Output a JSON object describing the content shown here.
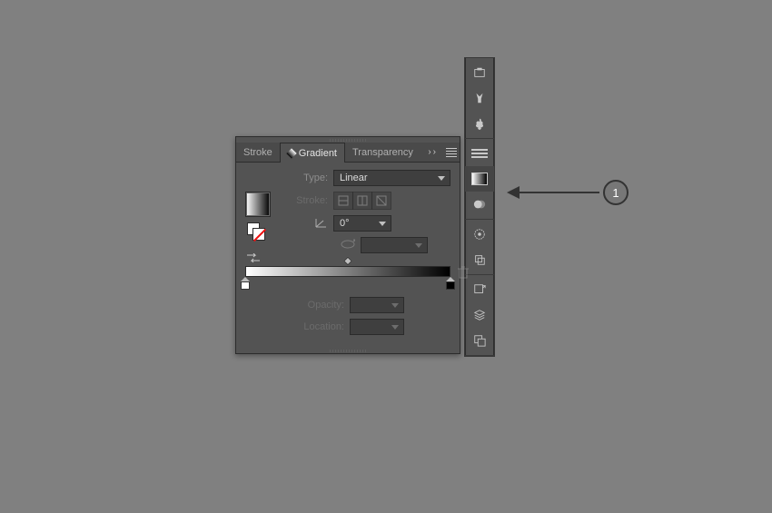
{
  "tabs": {
    "stroke": "Stroke",
    "gradient": "Gradient",
    "transparency": "Transparency",
    "collapse": "››"
  },
  "labels": {
    "type": "Type:",
    "stroke": "Stroke:",
    "angle": "0°",
    "opacity": "Opacity:",
    "location": "Location:"
  },
  "type_value": "Linear",
  "callout": {
    "n": "1"
  }
}
